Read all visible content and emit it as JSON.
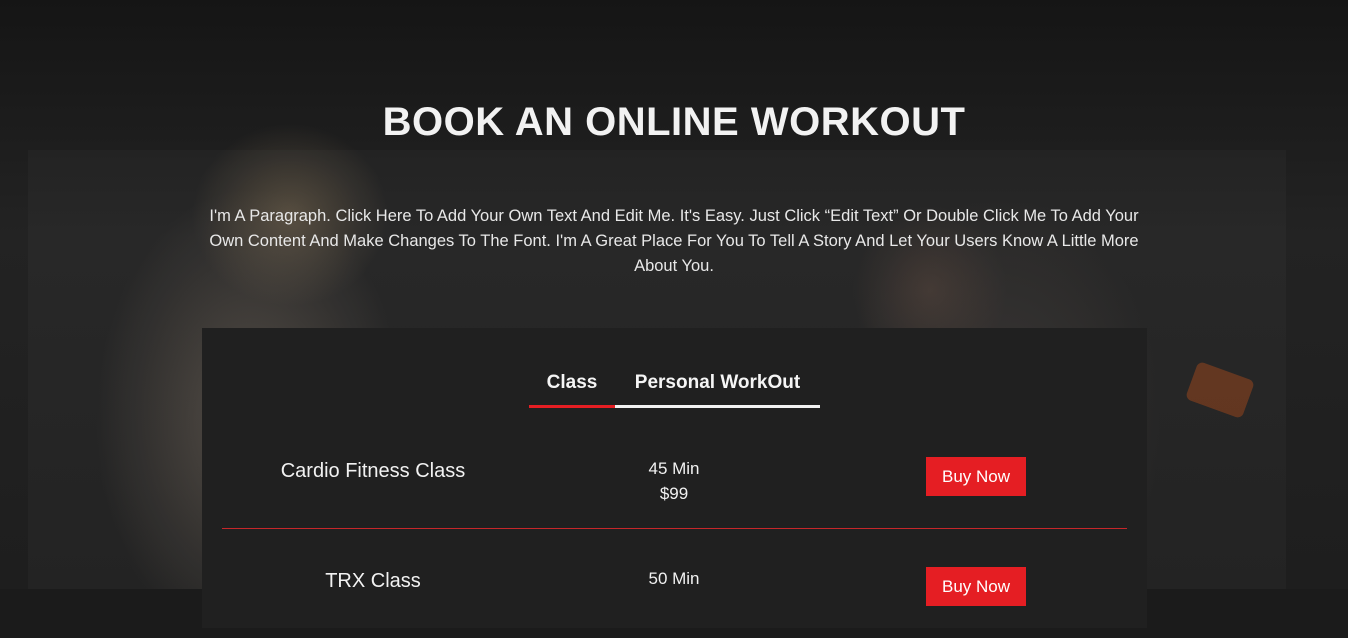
{
  "hero": {
    "title": "BOOK AN ONLINE WORKOUT",
    "paragraph": "I'm A Paragraph. Click Here To Add Your Own Text And Edit Me. It's Easy. Just Click “Edit Text” Or Double Click Me To Add Your Own Content And Make Changes To The Font. I'm A Great Place For You To Tell A Story And Let Your Users Know A Little More About You."
  },
  "tabs": [
    {
      "label": "Class",
      "active": true
    },
    {
      "label": "Personal WorkOut",
      "active": false
    }
  ],
  "classes": [
    {
      "name": "Cardio Fitness Class",
      "duration": "45 Min",
      "price": "$99",
      "button": "Buy Now"
    },
    {
      "name": "TRX Class",
      "duration": "50 Min",
      "price": "",
      "button": "Buy Now"
    }
  ],
  "colors": {
    "accent": "#e51e23",
    "panel": "#202020",
    "background": "#1b1b1b"
  }
}
